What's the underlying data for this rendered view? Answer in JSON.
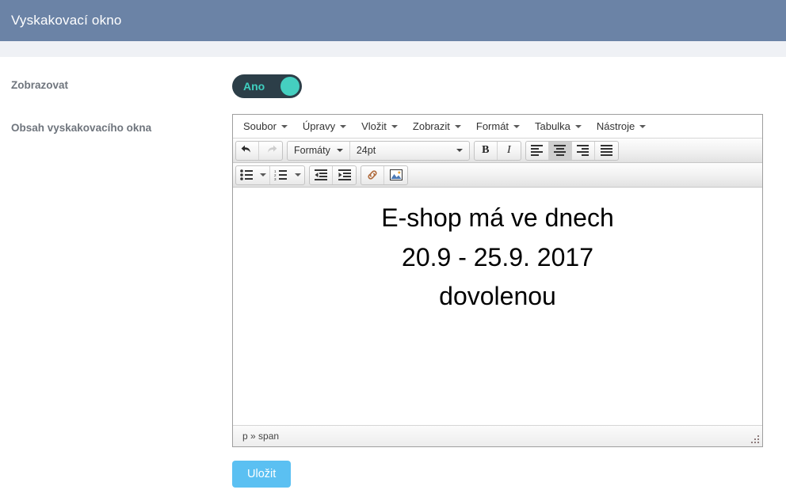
{
  "header": {
    "title": "Vyskakovací okno"
  },
  "form": {
    "show_label": "Zobrazovat",
    "content_label": "Obsah vyskakovacího okna",
    "toggle": {
      "name": "zobrazovat-toggle",
      "state_label": "Ano",
      "on_color": "#45cfc0",
      "track_color": "#2c3e48"
    },
    "save_label": "Uložit",
    "save_color": "#5bc0f2"
  },
  "editor": {
    "menubar": [
      {
        "label": "Soubor"
      },
      {
        "label": "Úpravy"
      },
      {
        "label": "Vložit"
      },
      {
        "label": "Zobrazit"
      },
      {
        "label": "Formát"
      },
      {
        "label": "Tabulka"
      },
      {
        "label": "Nástroje"
      }
    ],
    "toolbar_row1": {
      "undo": {
        "icon": "undo-icon",
        "title": "Zpět",
        "disabled": false
      },
      "redo": {
        "icon": "redo-icon",
        "title": "Znovu",
        "disabled": true
      },
      "formats_label": "Formáty",
      "fontsize_value": "24pt",
      "bold_label": "B",
      "italic_label": "I",
      "align": [
        {
          "icon": "align-left-icon",
          "active": false
        },
        {
          "icon": "align-center-icon",
          "active": true
        },
        {
          "icon": "align-right-icon",
          "active": false
        },
        {
          "icon": "align-justify-icon",
          "active": false
        }
      ]
    },
    "toolbar_row2": [
      {
        "icon": "bullet-list-icon",
        "has_caret": true
      },
      {
        "icon": "numbered-list-icon",
        "has_caret": true
      },
      {
        "icon": "outdent-icon",
        "has_caret": false
      },
      {
        "icon": "indent-icon",
        "has_caret": false
      },
      {
        "icon": "link-icon",
        "has_caret": false
      },
      {
        "icon": "image-icon",
        "has_caret": false
      }
    ],
    "content_lines": [
      "E-shop má ve dnech",
      "20.9 - 25.9. 2017",
      "dovolenou"
    ],
    "statusbar_path": "p » span"
  }
}
